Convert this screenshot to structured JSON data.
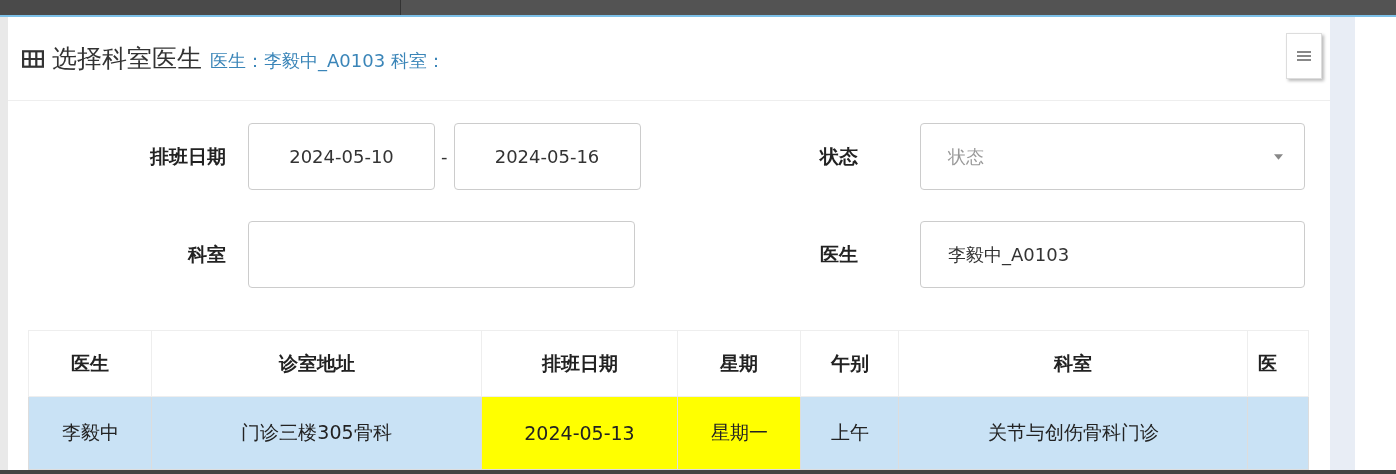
{
  "panel": {
    "title": "选择科室医生",
    "subtitle": "医生：李毅中_A0103 科室："
  },
  "form": [
    {
      "kind": "daterange",
      "label": "排班日期",
      "from": "2024-05-10",
      "separator": "-",
      "to": "2024-05-16"
    },
    {
      "kind": "select",
      "label": "状态",
      "placeholder": "状态"
    },
    {
      "kind": "input",
      "label": "科室"
    },
    {
      "kind": "input",
      "label": "医生",
      "value": "李毅中_A0103"
    }
  ],
  "table": {
    "columns": [
      "医生",
      "诊室地址",
      "排班日期",
      "星期",
      "午别",
      "科室",
      "医"
    ],
    "rows": [
      {
        "selected": true,
        "cells": [
          {
            "text": "李毅中",
            "highlight": false
          },
          {
            "text": "门诊三楼305骨科",
            "highlight": false
          },
          {
            "text": "2024-05-13",
            "highlight": true
          },
          {
            "text": "星期一",
            "highlight": true
          },
          {
            "text": "上午",
            "highlight": false
          },
          {
            "text": "关节与创伤骨科门诊",
            "highlight": false
          },
          {
            "highlight": false
          }
        ]
      }
    ]
  }
}
